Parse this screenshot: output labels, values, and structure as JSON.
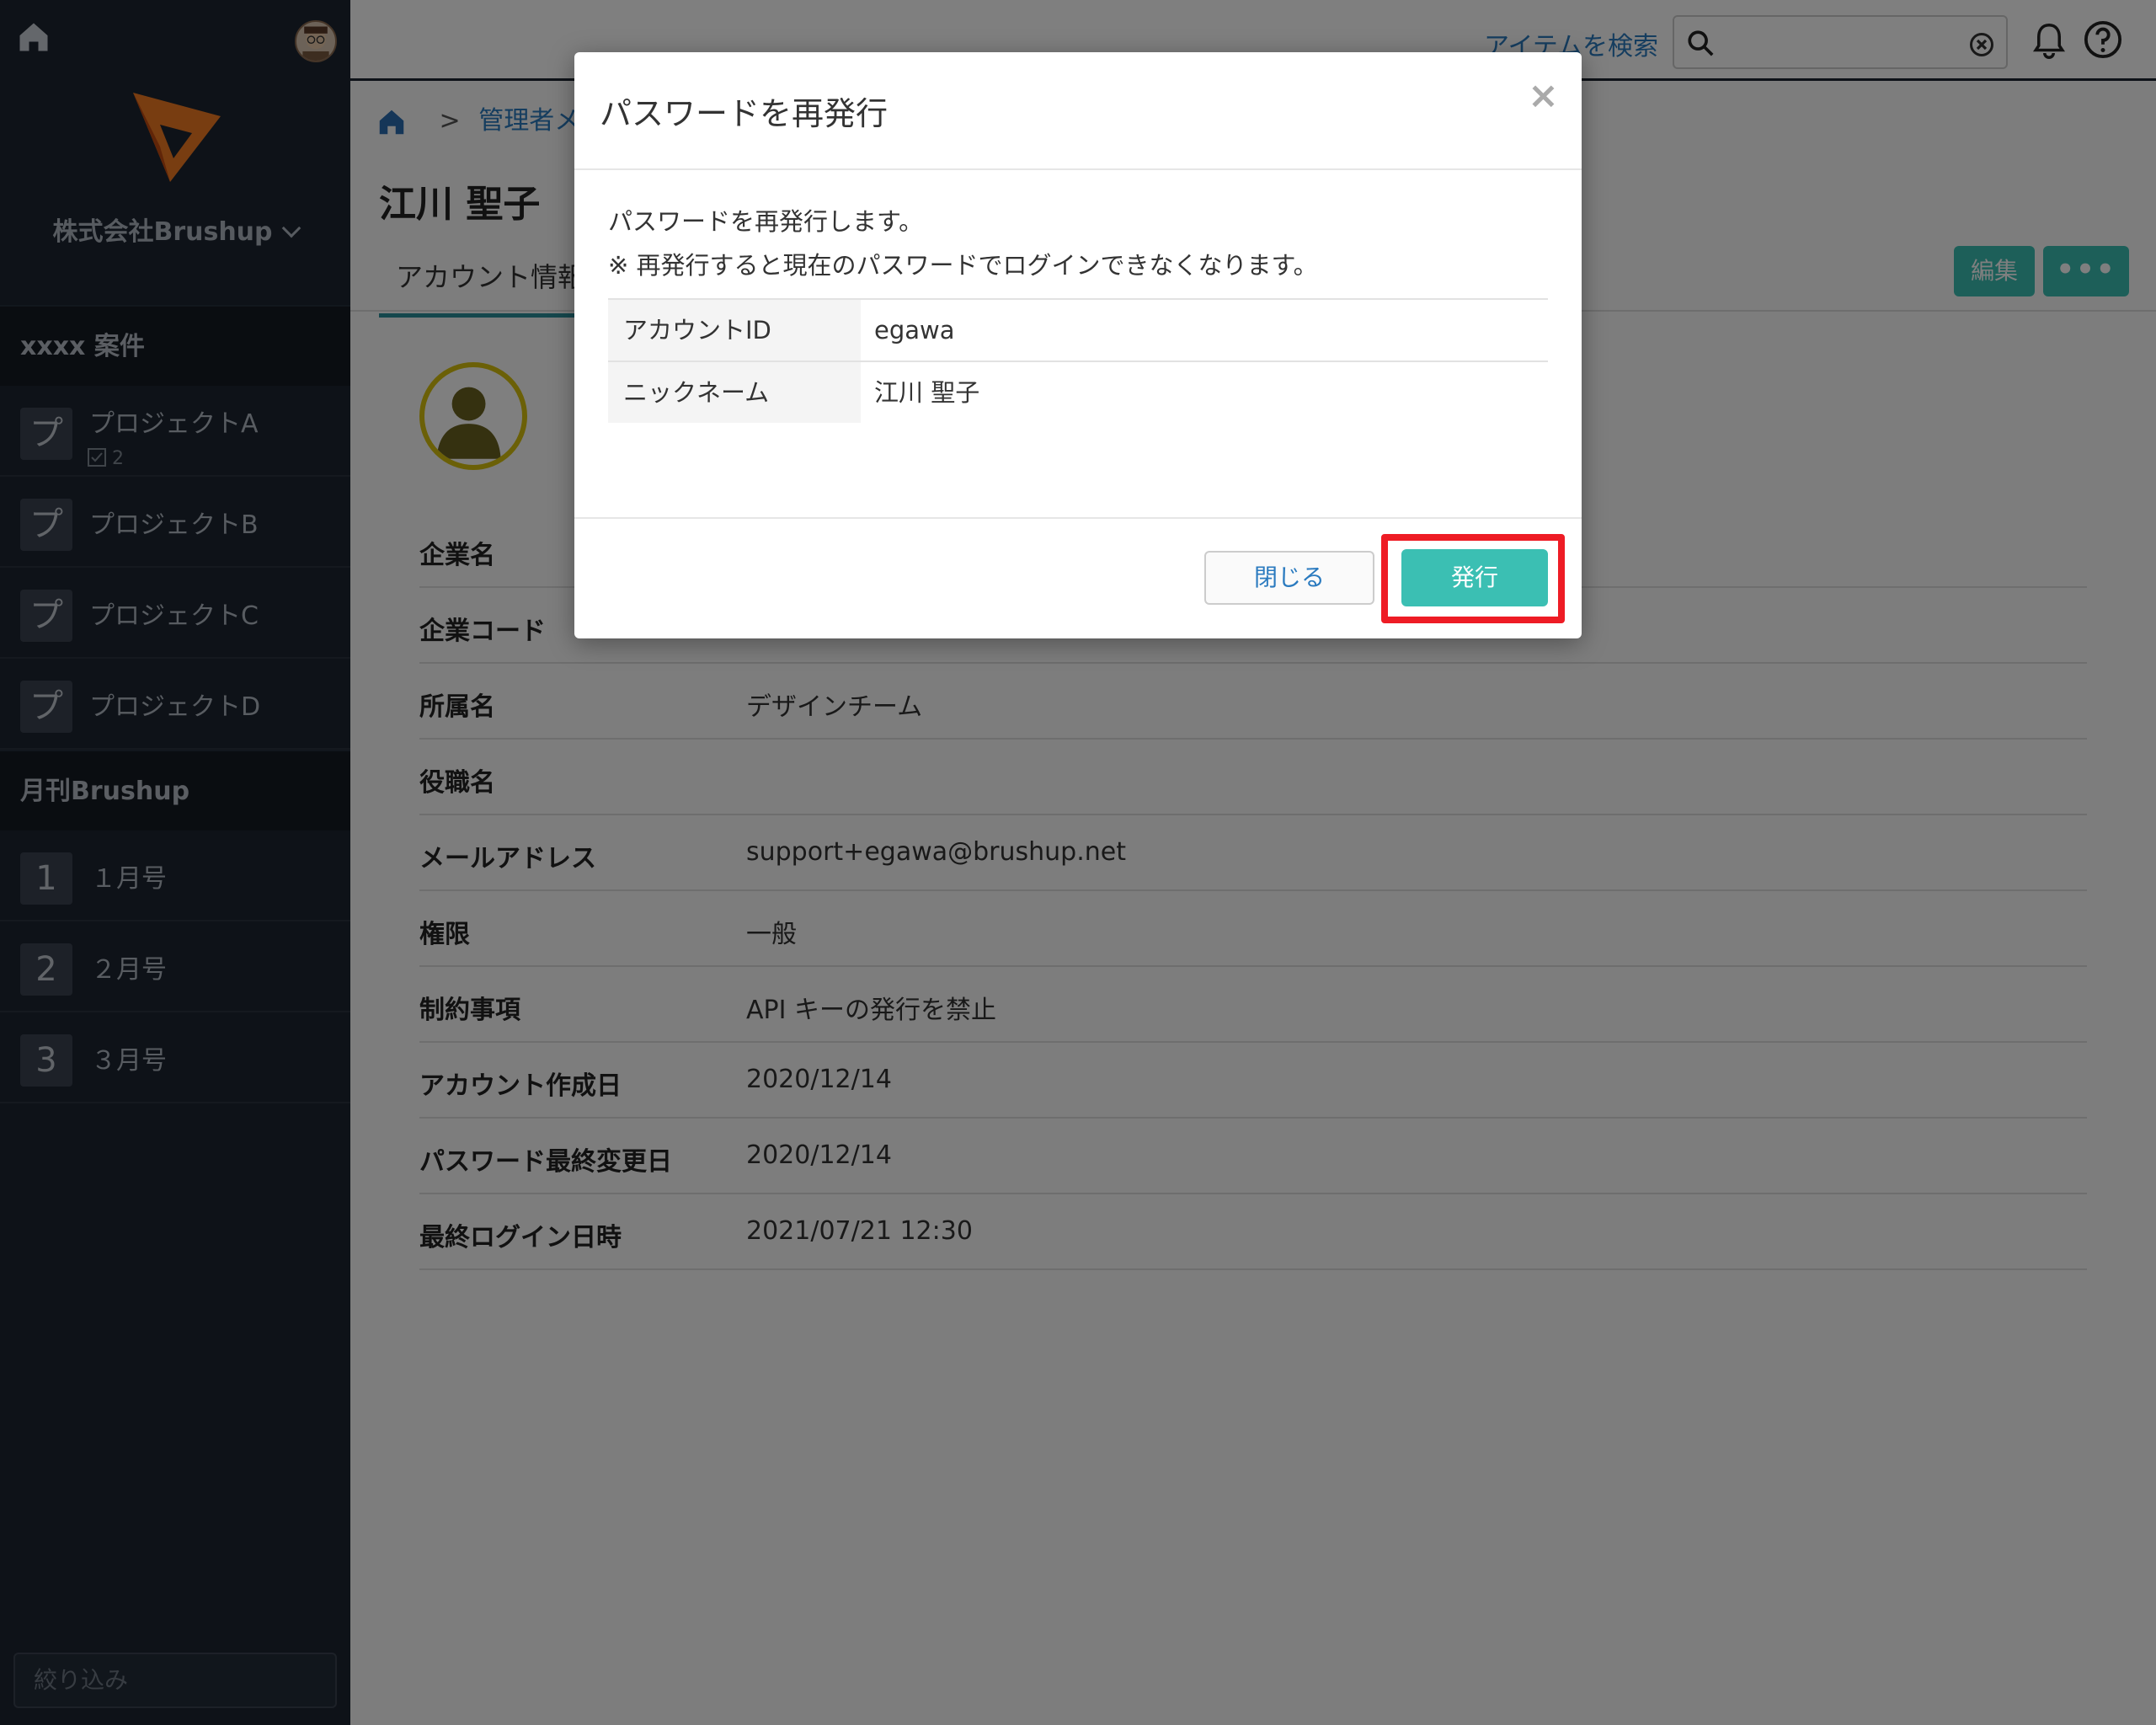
{
  "sidebar": {
    "company": "株式会社Brushup",
    "sections": [
      {
        "title": "xxxx 案件",
        "items": [
          {
            "badge": "プ",
            "label": "プロジェクトA",
            "sub": "2"
          },
          {
            "badge": "プ",
            "label": "プロジェクトB"
          },
          {
            "badge": "プ",
            "label": "プロジェクトC"
          },
          {
            "badge": "プ",
            "label": "プロジェクトD"
          }
        ]
      },
      {
        "title": "月刊Brushup",
        "items": [
          {
            "badge": "1",
            "label": "１月号"
          },
          {
            "badge": "2",
            "label": "２月号"
          },
          {
            "badge": "3",
            "label": "３月号"
          }
        ]
      }
    ],
    "filter_placeholder": "絞り込み"
  },
  "topbar": {
    "search_link": "アイテムを検索"
  },
  "breadcrumb": {
    "sep": ">",
    "item": "管理者メニ"
  },
  "page": {
    "title": "江川 聖子",
    "tab": "アカウント情報",
    "edit_button": "編集",
    "more_button": "•••"
  },
  "info": [
    {
      "key": "企業名",
      "value": ""
    },
    {
      "key": "企業コード",
      "value": ""
    },
    {
      "key": "所属名",
      "value": "デザインチーム"
    },
    {
      "key": "役職名",
      "value": ""
    },
    {
      "key": "メールアドレス",
      "value": "support+egawa@brushup.net"
    },
    {
      "key": "権限",
      "value": "一般"
    },
    {
      "key": "制約事項",
      "value": "API キーの発行を禁止"
    },
    {
      "key": "アカウント作成日",
      "value": "2020/12/14"
    },
    {
      "key": "パスワード最終変更日",
      "value": "2020/12/14"
    },
    {
      "key": "最終ログイン日時",
      "value": "2021/07/21 12:30"
    }
  ],
  "modal": {
    "title": "パスワードを再発行",
    "close_x": "×",
    "message1": "パスワードを再発行します。",
    "message2": "※ 再発行すると現在のパスワードでログインできなくなります。",
    "rows": [
      {
        "key": "アカウントID",
        "value": "egawa"
      },
      {
        "key": "ニックネーム",
        "value": "江川 聖子"
      }
    ],
    "close_button": "閉じる",
    "issue_button": "発行"
  },
  "colors": {
    "accent": "#3bbfb3",
    "link": "#2a7abf",
    "sidebar": "#1c2430",
    "highlight": "#ee1c25"
  }
}
